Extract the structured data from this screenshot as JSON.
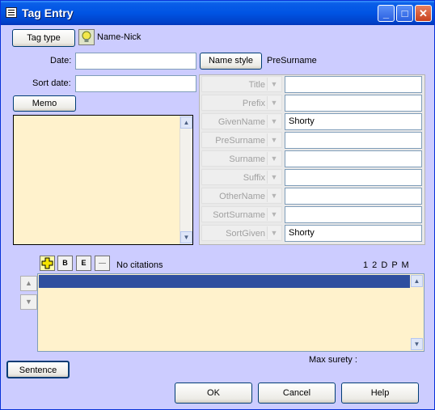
{
  "window": {
    "title": "Tag Entry",
    "minimize": "_",
    "maximize": "□",
    "close": "✕"
  },
  "tag": {
    "button": "Tag type",
    "name": "Name-Nick",
    "icon": "lightbulb-icon"
  },
  "date": {
    "label": "Date:",
    "value": ""
  },
  "sort_date": {
    "label": "Sort date:",
    "value": ""
  },
  "name_style": {
    "button": "Name style",
    "value": "PreSurname"
  },
  "memo": {
    "button": "Memo",
    "value": ""
  },
  "name_parts": [
    {
      "label": "Title",
      "value": ""
    },
    {
      "label": "Prefix",
      "value": ""
    },
    {
      "label": "GivenName",
      "value": "Shorty"
    },
    {
      "label": "PreSurname",
      "value": ""
    },
    {
      "label": "Surname",
      "value": ""
    },
    {
      "label": "Suffix",
      "value": ""
    },
    {
      "label": "OtherName",
      "value": ""
    },
    {
      "label": "SortSurname",
      "value": ""
    },
    {
      "label": "SortGiven",
      "value": "Shorty"
    }
  ],
  "citations": {
    "status": "No citations",
    "columns": "1 2 D P M",
    "tools": [
      {
        "name": "add-citation-icon",
        "glyph": "+"
      },
      {
        "name": "edit-citation-icon",
        "glyph": "B"
      },
      {
        "name": "memo-citation-icon",
        "glyph": "E"
      },
      {
        "name": "remove-citation-icon",
        "glyph": "—"
      }
    ]
  },
  "max_surety": {
    "label": "Max surety :"
  },
  "buttons": {
    "sentence": "Sentence",
    "ok": "OK",
    "cancel": "Cancel",
    "help": "Help"
  },
  "colors": {
    "background": "#ccccff",
    "memo": "#fff2cc",
    "selection": "#2f4f9f"
  }
}
